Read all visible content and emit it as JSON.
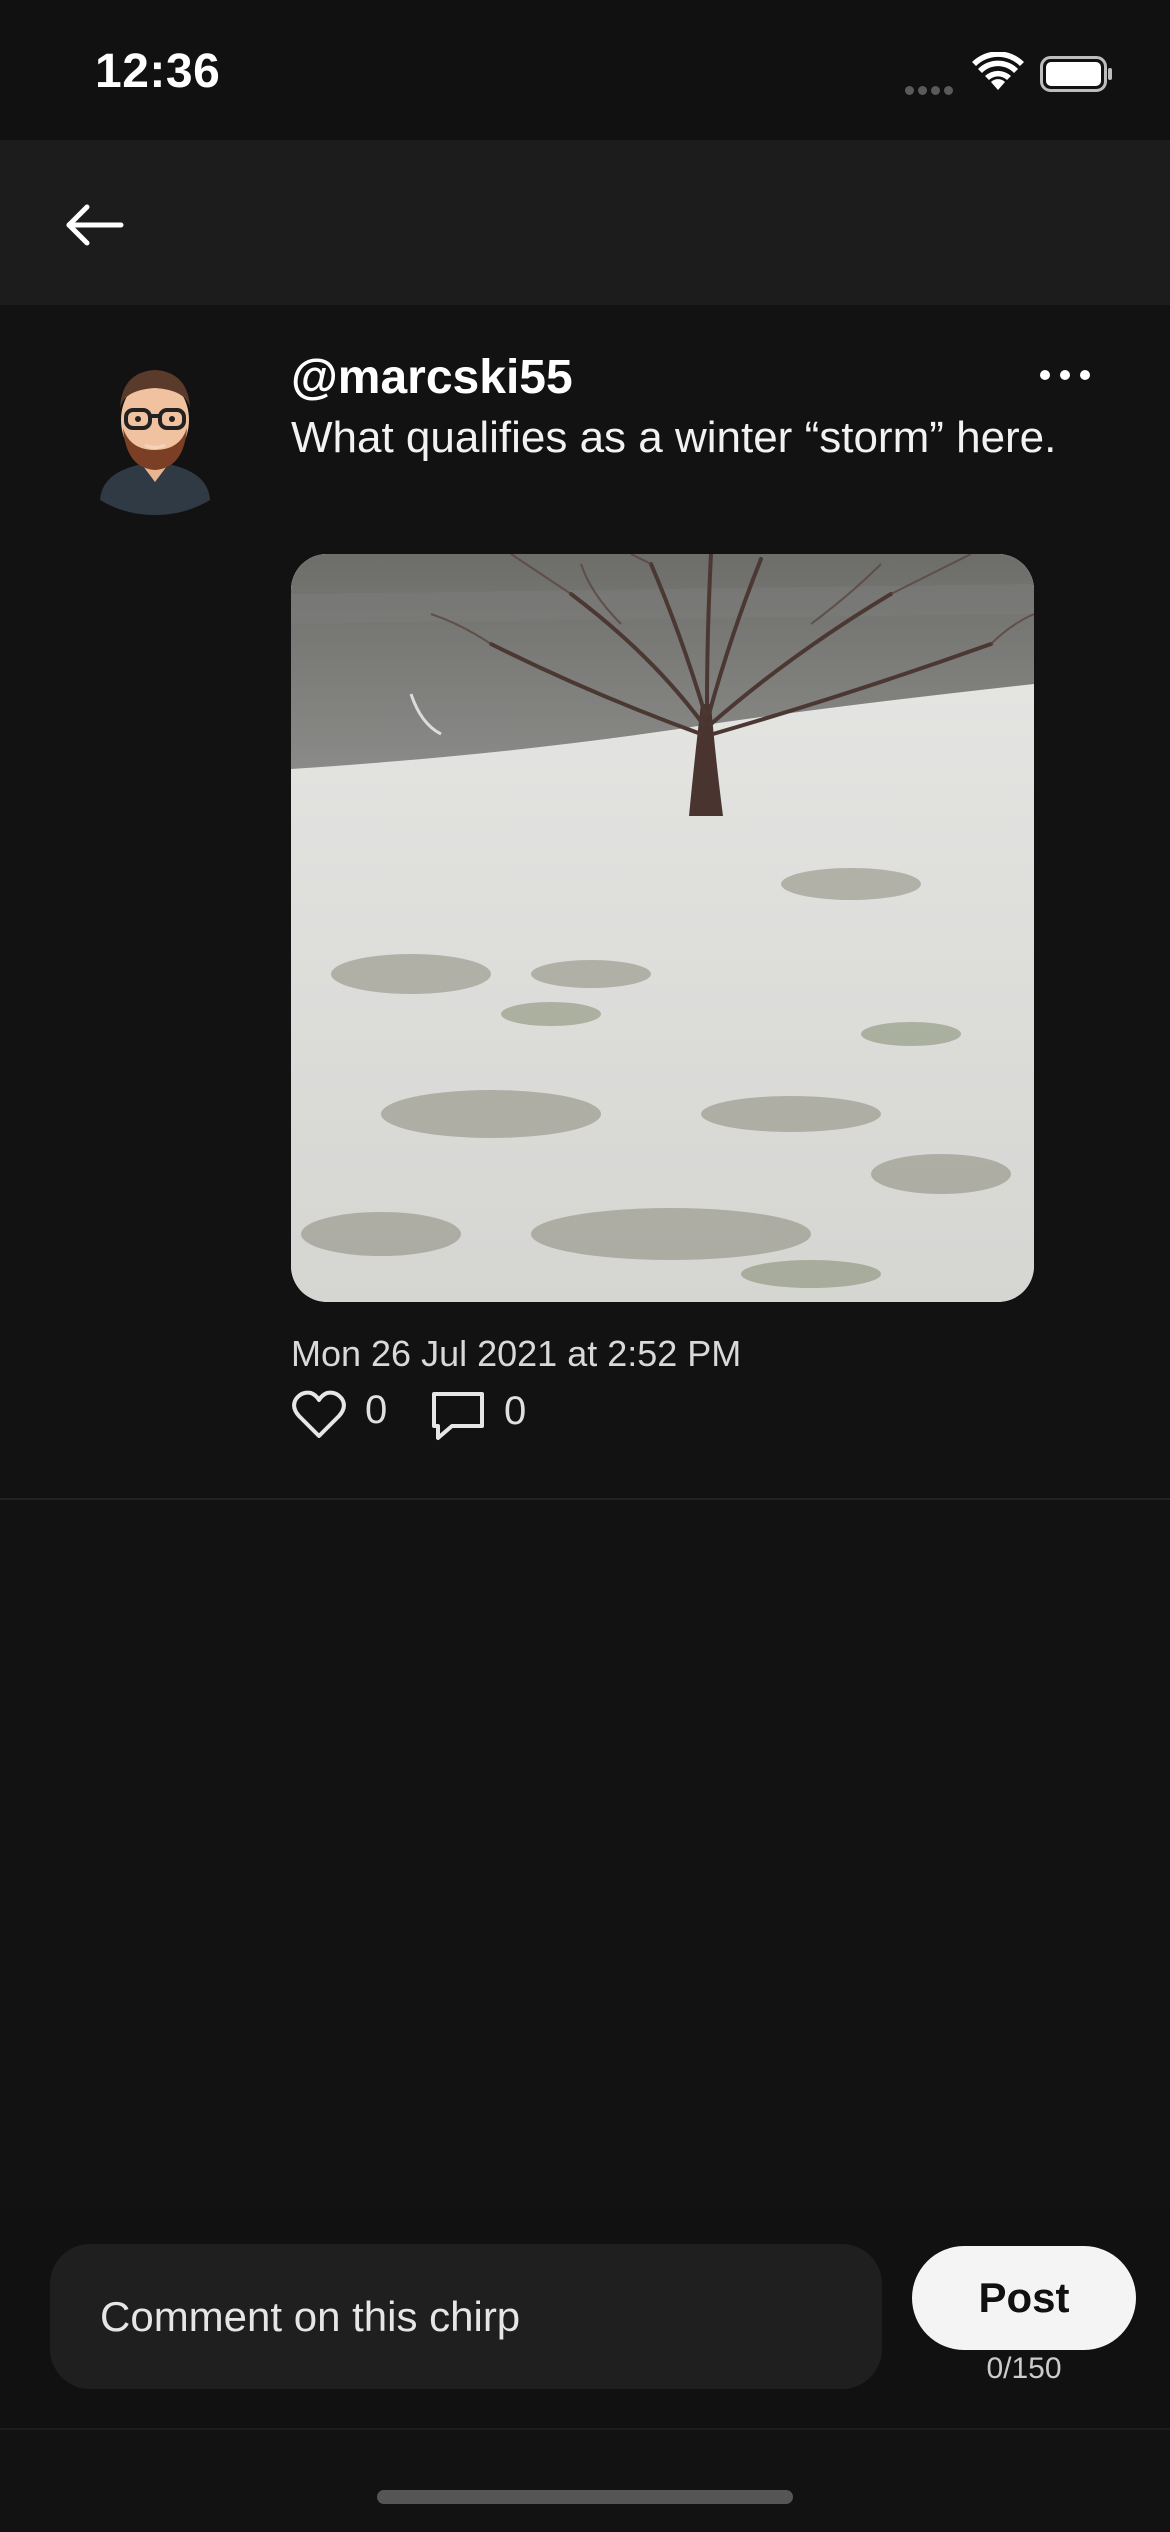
{
  "status_bar": {
    "time": "12:36",
    "icons": [
      "cellular-signal-icon",
      "wifi-icon",
      "battery-icon"
    ]
  },
  "nav": {
    "back_icon": "back-arrow-icon"
  },
  "post": {
    "username": "@marcski55",
    "text": "What qualifies as a winter “storm” here.",
    "timestamp": "Mon 26 Jul 2021 at 2:52 PM",
    "likes": "0",
    "comments": "0",
    "icons": [
      "avatar",
      "more-options-icon",
      "heart-icon",
      "comment-icon"
    ]
  },
  "composer": {
    "placeholder": "Comment on this chirp",
    "post_label": "Post",
    "char_counter": "0/150"
  },
  "colors": {
    "background": "#121212",
    "nav_background": "#1c1c1c",
    "input_background": "#1f1f1f",
    "button_background": "#f4f4f4"
  }
}
